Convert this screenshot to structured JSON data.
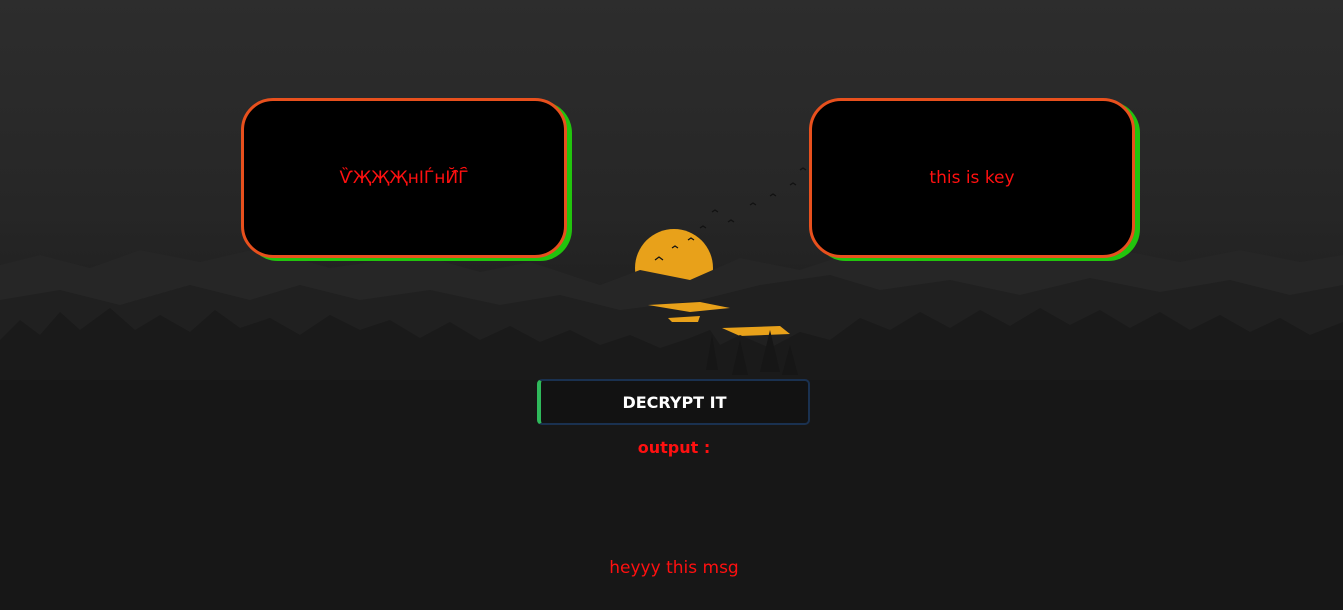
{
  "cipher_box": {
    "text": "ѶҖҖҖнӀЃнЙ҄Г҄"
  },
  "key_box": {
    "text": "this is key"
  },
  "decrypt_button": {
    "label": "DECRYPT IT"
  },
  "output": {
    "label": "output :"
  },
  "message": {
    "text": "heyyy this msg"
  },
  "colors": {
    "box_border": "#e8501d",
    "box_shadow": "#22c40d",
    "text_red": "#ff1010",
    "button_accent": "#2fb95b",
    "button_border": "#1a3150",
    "moon": "#e8a11a"
  },
  "background": {
    "scene": "night-forest-landscape-with-orange-moon-and-birds"
  }
}
